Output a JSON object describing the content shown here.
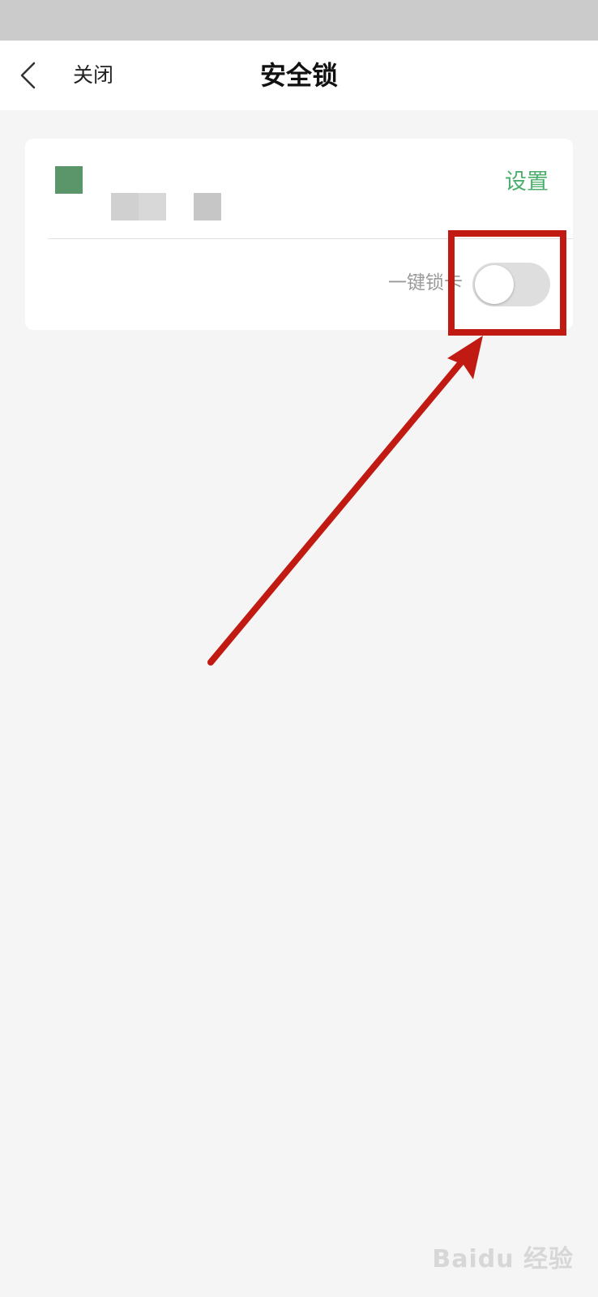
{
  "nav": {
    "close_label": "关闭",
    "title": "安全锁"
  },
  "card": {
    "settings_label": "设置",
    "lock_label": "一键锁卡",
    "toggle_on": false
  },
  "watermark": {
    "text": "Baidu 经验"
  },
  "colors": {
    "accent_green": "#4caf6e",
    "avatar_green": "#5a9669",
    "annotation_red": "#c11a12"
  },
  "icons": {
    "back": "chevron-left-icon"
  }
}
